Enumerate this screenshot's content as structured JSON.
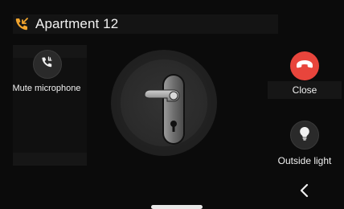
{
  "header": {
    "title": "Apartment 12",
    "icon": "incoming-call-icon"
  },
  "actions": {
    "mute": {
      "label": "Mute microphone",
      "icon": "phone-mute-icon"
    },
    "close": {
      "label": "Close",
      "icon": "hang-up-icon",
      "color": "#e8453c"
    },
    "outside_light": {
      "label": "Outside light",
      "icon": "lightbulb-icon"
    },
    "back": {
      "icon": "chevron-left-icon"
    }
  },
  "center": {
    "icon": "door-handle-icon"
  },
  "colors": {
    "accent": "#f2a52e",
    "danger": "#e8453c",
    "background": "#0b0b0b"
  }
}
